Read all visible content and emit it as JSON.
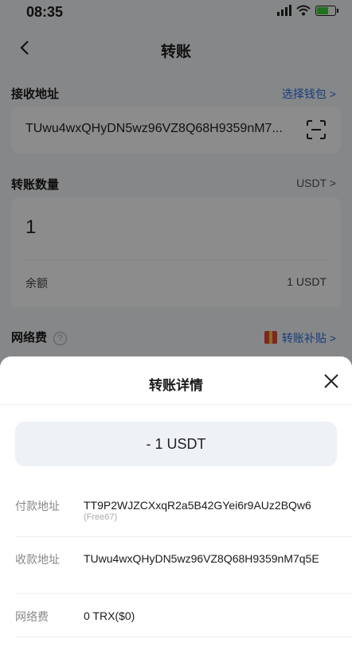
{
  "status": {
    "time": "08:35"
  },
  "nav": {
    "title": "转账"
  },
  "receive": {
    "label": "接收地址",
    "select_wallet": "选择钱包 >",
    "address": "TUwu4wxQHyDN5wz96VZ8Q68H9359nM7..."
  },
  "amount": {
    "label": "转账数量",
    "token": "USDT >",
    "value": "1",
    "balance_label": "余额",
    "balance_value": "1 USDT"
  },
  "fee": {
    "label": "网络费",
    "help": "?",
    "subsidy": "转账补贴 >"
  },
  "sheet": {
    "title": "转账详情",
    "amount": "- 1 USDT",
    "details": [
      {
        "label": "付款地址",
        "value": "TT9P2WJZCXxqR2a5B42GYei6r9AUz2BQw6",
        "sub": "(Free67)"
      },
      {
        "label": "收款地址",
        "value": "TUwu4wxQHyDN5wz96VZ8Q68H9359nM7q5E",
        "sub": ""
      },
      {
        "label": "网络费",
        "value": "0 TRX($0)",
        "sub": ""
      }
    ]
  },
  "colors": {
    "accent": "#2b6fe3",
    "background": "#f5f6f8"
  }
}
